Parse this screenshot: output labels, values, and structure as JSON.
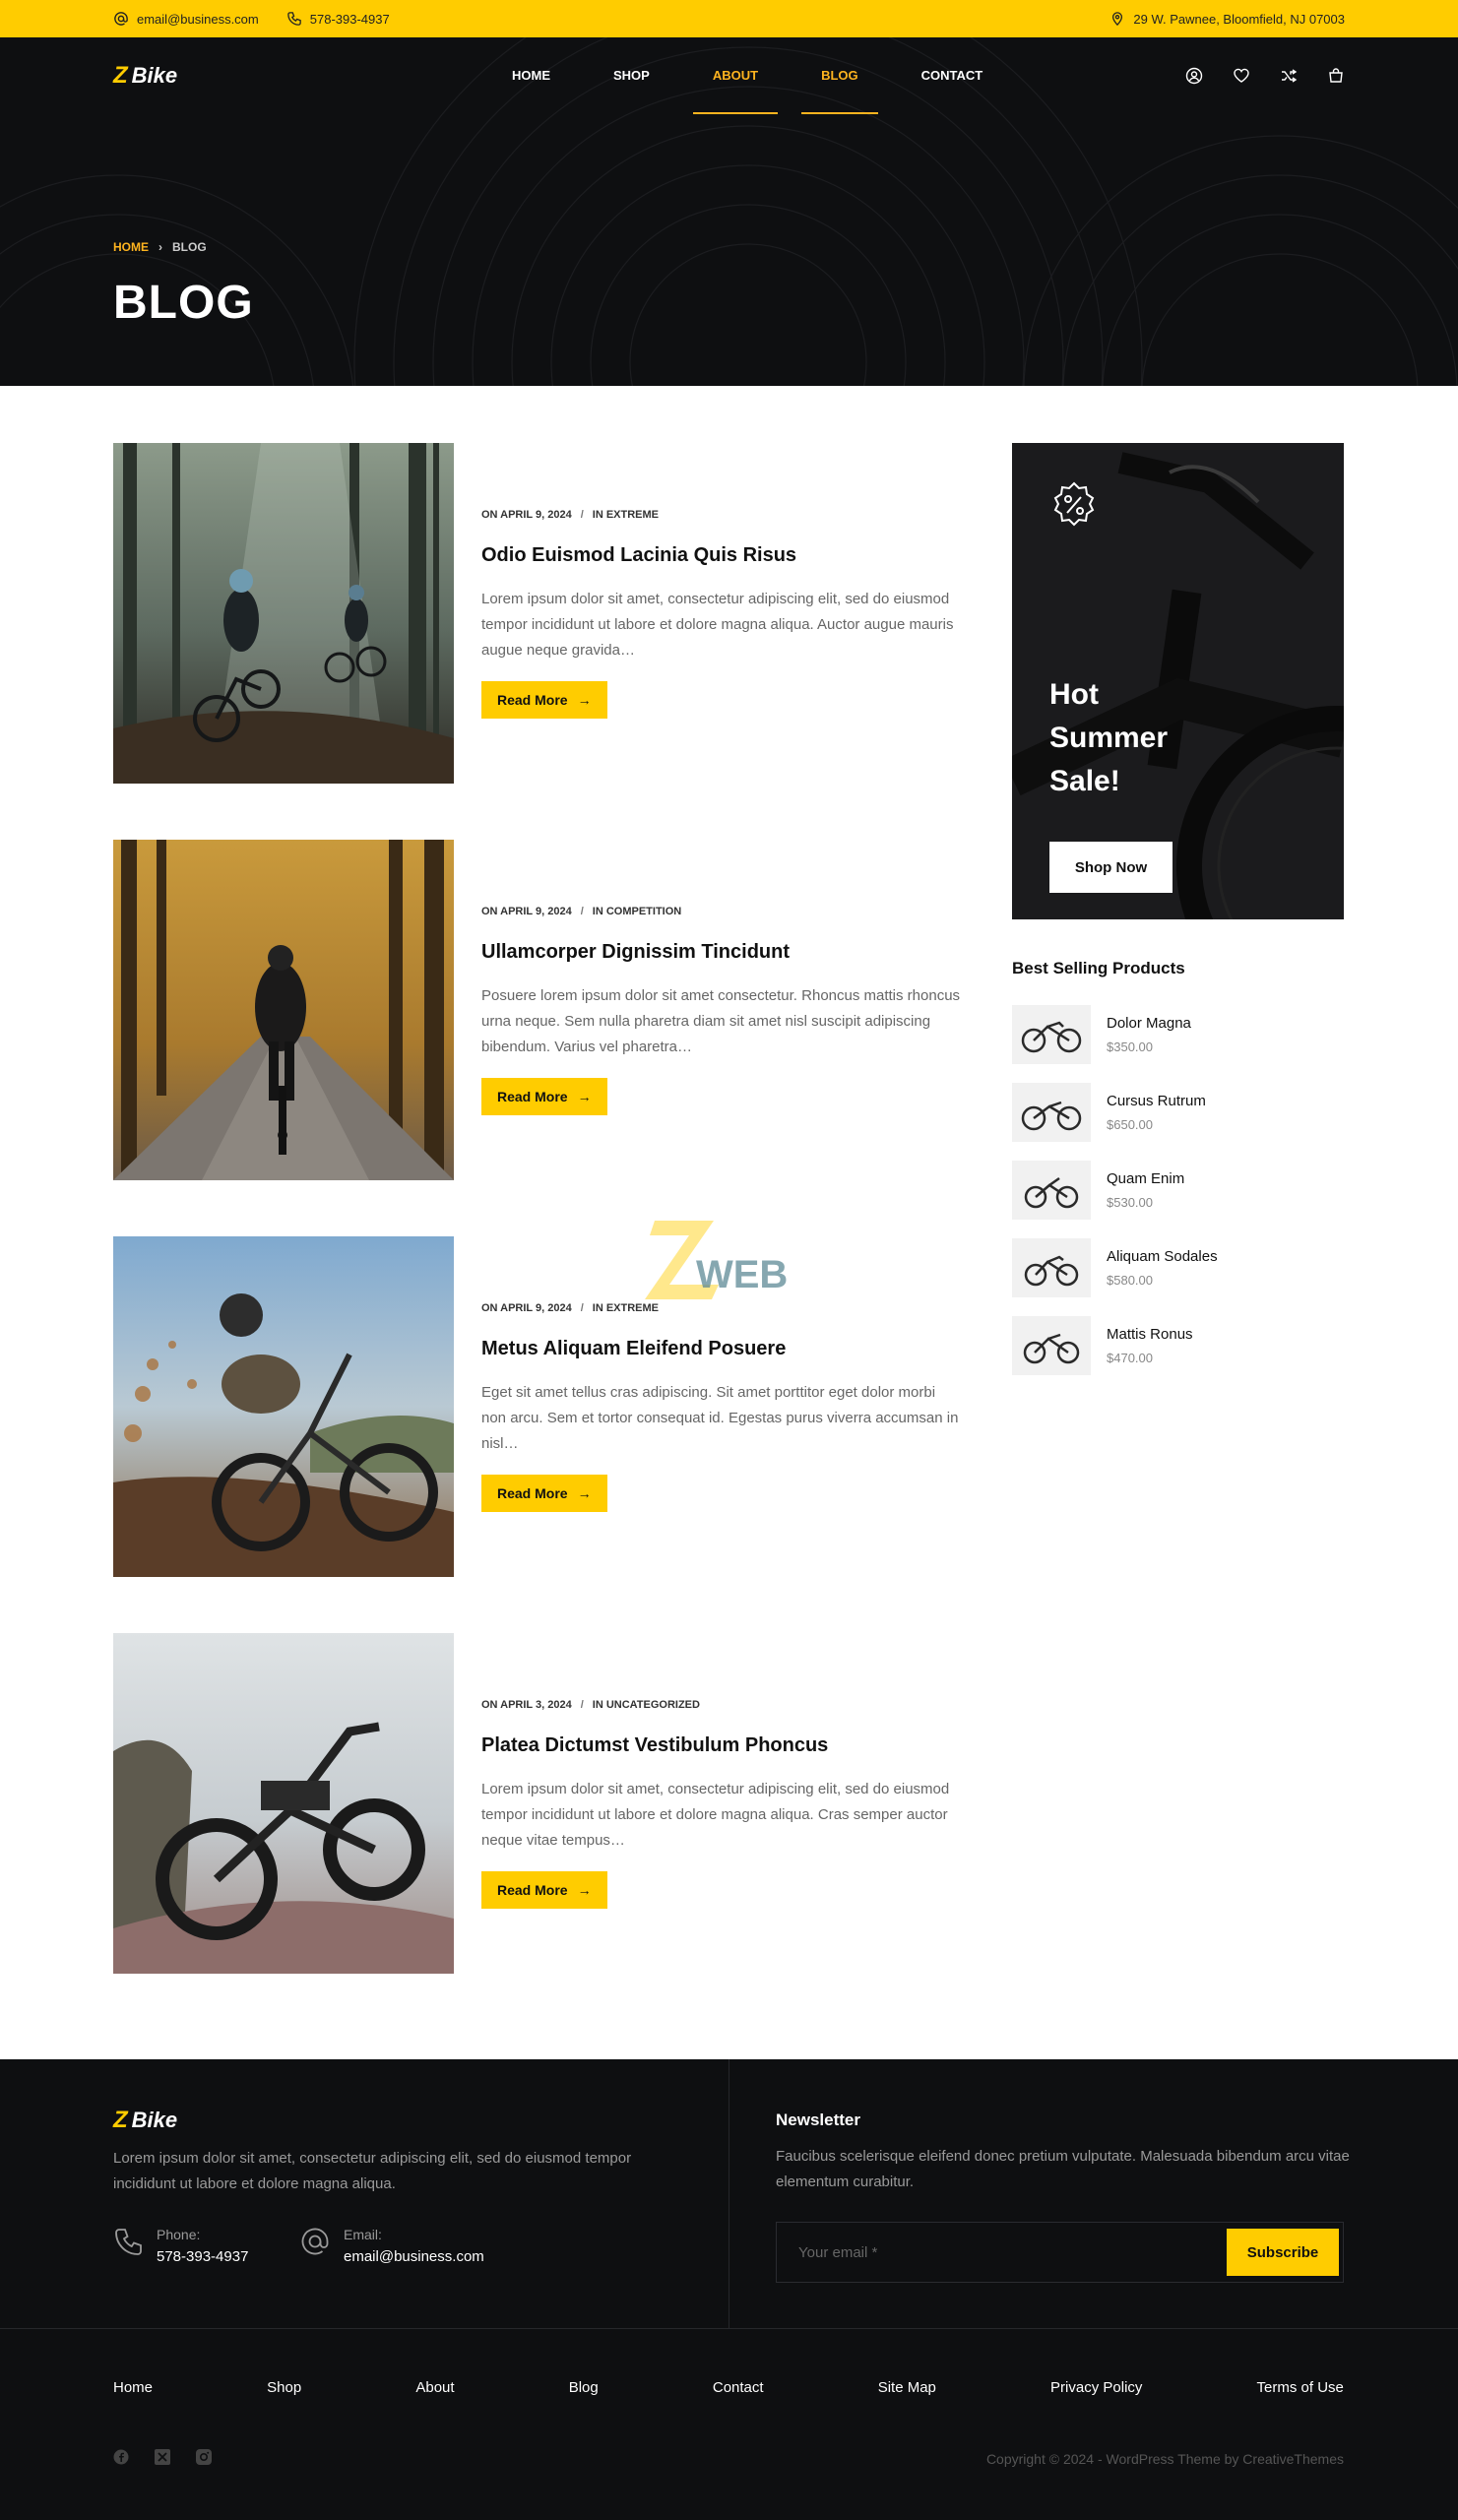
{
  "topbar": {
    "email": "email@business.com",
    "phone": "578-393-4937",
    "address": "29 W. Pawnee, Bloomfield, NJ 07003"
  },
  "brand": {
    "name": "Bike",
    "mark": "Z"
  },
  "nav": {
    "items": [
      {
        "label": "HOME",
        "active": false
      },
      {
        "label": "SHOP",
        "active": false
      },
      {
        "label": "ABOUT",
        "active": true
      },
      {
        "label": "BLOG",
        "active": true
      },
      {
        "label": "CONTACT",
        "active": false
      }
    ],
    "icons": [
      "user-icon",
      "heart-icon",
      "compare-icon",
      "cart-icon"
    ]
  },
  "breadcrumb": {
    "home": "HOME",
    "separator": "›",
    "current": "BLOG"
  },
  "page_title": "BLOG",
  "posts": [
    {
      "date": "ON APRIL 9, 2024",
      "category": "IN EXTREME",
      "title": "Odio Euismod Lacinia Quis Risus",
      "excerpt": "Lorem ipsum dolor sit amet, consectetur adipiscing elit, sed do eiusmod tempor incididunt ut labore et dolore magna aliqua. Auctor augue mauris augue neque gravida…",
      "button": "Read More"
    },
    {
      "date": "ON APRIL 9, 2024",
      "category": "IN COMPETITION",
      "title": "Ullamcorper Dignissim Tincidunt",
      "excerpt": "Posuere lorem ipsum dolor sit amet consectetur. Rhoncus mattis rhoncus urna neque. Sem nulla pharetra diam sit amet nisl suscipit adipiscing bibendum. Varius vel pharetra…",
      "button": "Read More"
    },
    {
      "date": "ON APRIL 9, 2024",
      "category": "IN EXTREME",
      "title": "Metus Aliquam Eleifend Posuere",
      "excerpt": "Eget sit amet tellus cras adipiscing. Sit amet porttitor eget dolor morbi non arcu. Sem et tortor consequat id. Egestas purus viverra accumsan in nisl…",
      "button": "Read More"
    },
    {
      "date": "ON APRIL 3, 2024",
      "category": "IN UNCATEGORIZED",
      "title": "Platea Dictumst Vestibulum Phoncus",
      "excerpt": "Lorem ipsum dolor sit amet, consectetur adipiscing elit, sed do eiusmod tempor incididunt ut labore et dolore magna aliqua. Cras semper auctor neque vitae tempus…",
      "button": "Read More"
    }
  ],
  "promo": {
    "headline": "Hot Summer Sale!",
    "button": "Shop Now"
  },
  "sidebar": {
    "title": "Best Selling Products",
    "products": [
      {
        "name": "Dolor Magna",
        "price": "$350.00"
      },
      {
        "name": "Cursus Rutrum",
        "price": "$650.00"
      },
      {
        "name": "Quam Enim",
        "price": "$530.00"
      },
      {
        "name": "Aliquam Sodales",
        "price": "$580.00"
      },
      {
        "name": "Mattis Ronus",
        "price": "$470.00"
      }
    ]
  },
  "watermark": {
    "text": "WEB",
    "mark": "Z"
  },
  "footer": {
    "description": "Lorem ipsum dolor sit amet, consectetur adipiscing elit, sed do eiusmod tempor incididunt ut labore et dolore magna aliqua.",
    "phone_label": "Phone:",
    "phone": "578-393-4937",
    "email_label": "Email:",
    "email": "email@business.com",
    "newsletter_title": "Newsletter",
    "newsletter_desc": "Faucibus scelerisque eleifend donec pretium vulputate. Malesuada bibendum arcu vitae elementum curabitur.",
    "email_placeholder": "Your email *",
    "subscribe": "Subscribe",
    "links": [
      "Home",
      "Shop",
      "About",
      "Blog",
      "Contact",
      "Site Map",
      "Privacy Policy",
      "Terms of Use"
    ],
    "social": [
      "facebook-icon",
      "x-icon",
      "instagram-icon"
    ],
    "copyright": "Copyright © 2024 - WordPress Theme by CreativeThemes"
  },
  "colors": {
    "accent": "#ffcc00",
    "nav_active": "#ffb41f",
    "dark": "#0e0f11"
  }
}
